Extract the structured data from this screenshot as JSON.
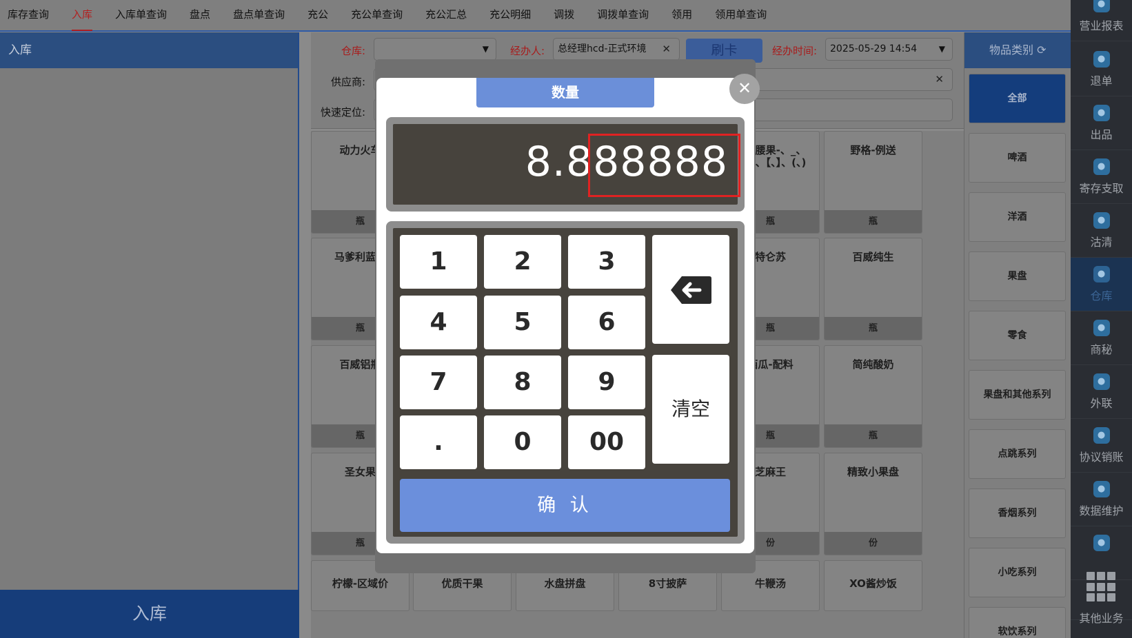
{
  "topnav": {
    "tabs": [
      "库存查询",
      "入库",
      "入库单查询",
      "盘点",
      "盘点单查询",
      "充公",
      "充公单查询",
      "充公汇总",
      "充公明细",
      "调拨",
      "调拨单查询",
      "领用",
      "领用单查询"
    ],
    "active_index": 1
  },
  "left": {
    "title": "入库",
    "bottom_button": "入库"
  },
  "form": {
    "warehouse_label": "仓库:",
    "warehouse_value": "",
    "operator_label": "经办人:",
    "operator_value": "总经理hcd-正式环境",
    "swipe_button": "刷卡",
    "time_label": "经办时间:",
    "time_value": "2025-05-29 14:54",
    "supplier_label": "供应商:",
    "quick_locate_label": "快速定位:"
  },
  "products": [
    {
      "name": "动力火车",
      "unit": "瓶"
    },
    {
      "name": "腰果腰果-、_、【、】、【、】、(、)",
      "unit": "瓶"
    },
    {
      "name": "野格-例送",
      "unit": "瓶"
    },
    {
      "name": "马爹利蓝钻",
      "unit": "瓶"
    },
    {
      "name": "特仑苏",
      "unit": "瓶"
    },
    {
      "name": "百威纯生",
      "unit": "瓶"
    },
    {
      "name": "百威铝瓶",
      "unit": "瓶"
    },
    {
      "name": "西瓜-配料",
      "unit": "瓶"
    },
    {
      "name": "简纯酸奶",
      "unit": "瓶"
    },
    {
      "name": "圣女果",
      "unit": "瓶"
    },
    {
      "name": "芝麻王",
      "unit": "份"
    },
    {
      "name": "精致小果盘",
      "unit": "份"
    },
    {
      "name": "柠檬-区域价",
      "unit": ""
    },
    {
      "name": "优质干果",
      "unit": ""
    },
    {
      "name": "水盘拼盘",
      "unit": ""
    },
    {
      "name": "8寸披萨",
      "unit": ""
    },
    {
      "name": "牛鞭汤",
      "unit": ""
    },
    {
      "name": "XO酱炒饭",
      "unit": ""
    }
  ],
  "categories": {
    "title": "物品类别",
    "items": [
      "全部",
      "啤酒",
      "洋酒",
      "果盘",
      "零食",
      "果盘和其他系列",
      "点跳系列",
      "香烟系列",
      "小吃系列",
      "软饮系列"
    ]
  },
  "sidebar": {
    "items": [
      {
        "label": "营业报表",
        "icon": "report-icon"
      },
      {
        "label": "退单",
        "icon": "refund-icon"
      },
      {
        "label": "出品",
        "icon": "output-icon"
      },
      {
        "label": "寄存支取",
        "icon": "deposit-icon"
      },
      {
        "label": "沽清",
        "icon": "soldout-icon"
      },
      {
        "label": "仓库",
        "icon": "warehouse-icon"
      },
      {
        "label": "商秘",
        "icon": "secretary-icon"
      },
      {
        "label": "外联",
        "icon": "contact-icon"
      },
      {
        "label": "协议销账",
        "icon": "agreement-icon"
      },
      {
        "label": "数据维护",
        "icon": "data-icon"
      },
      {
        "label": "",
        "icon": "user-icon"
      },
      {
        "label": "其他业务",
        "icon": "grid-icon"
      }
    ]
  },
  "dialog": {
    "title": "数量",
    "value_prefix": "8.",
    "value_highlighted": "888888",
    "keys": [
      "1",
      "2",
      "3",
      "4",
      "5",
      "6",
      "7",
      "8",
      "9",
      ".",
      "0",
      "00"
    ],
    "clear_label": "清空",
    "confirm_label": "确 认"
  },
  "colors": {
    "accent_blue": "#6b8fd9",
    "nav_active": "#b22020",
    "highlight_box": "#e02222"
  }
}
